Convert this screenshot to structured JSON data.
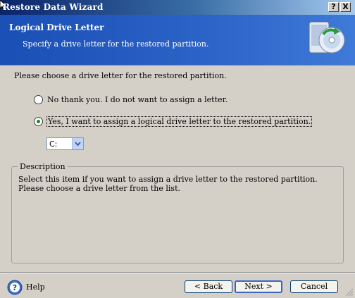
{
  "window": {
    "title": "Restore Data Wizard",
    "help_glyph": "?",
    "close_glyph": "X"
  },
  "header": {
    "title": "Logical Drive Letter",
    "subtitle": "Specify a drive letter for the restored partition."
  },
  "main": {
    "prompt": "Please choose a drive letter for the restored partition.",
    "options": [
      {
        "label": "No thank you. I do not want to assign a letter.",
        "selected": false
      },
      {
        "label": "Yes, I want to assign a logical drive letter to the restored partition.",
        "selected": true
      }
    ],
    "drive_select": {
      "value": "C:"
    }
  },
  "description": {
    "title": "Description",
    "text": "Select this item if you want to assign a drive letter to the restored partition. Please choose a drive letter from the list."
  },
  "footer": {
    "help": "Help",
    "back": "< Back",
    "next": "Next >",
    "cancel": "Cancel"
  },
  "colors": {
    "banner": "#2d64c8",
    "radio_dot": "#1d8a1d"
  },
  "icons": {
    "help": "question-circle-icon",
    "wizard": "disc-restore-icon"
  }
}
